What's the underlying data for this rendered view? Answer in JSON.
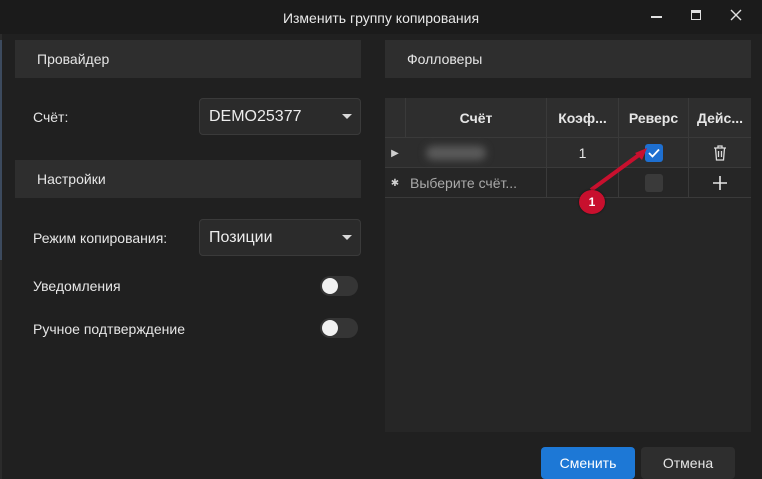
{
  "window": {
    "title": "Изменить группу копирования"
  },
  "provider": {
    "header": "Провайдер",
    "account_label": "Счёт:",
    "account_value": "DEMO25377"
  },
  "settings": {
    "header": "Настройки",
    "copy_mode_label": "Режим копирования:",
    "copy_mode_value": "Позиции",
    "notifications_label": "Уведомления",
    "notifications_on": false,
    "manual_confirm_label": "Ручное подтверждение",
    "manual_confirm_on": false
  },
  "followers": {
    "header": "Фолловеры",
    "columns": [
      "Счёт",
      "Коэф...",
      "Реверс",
      "Дейс..."
    ],
    "rows": [
      {
        "account": "",
        "coef": "1",
        "reverse": true,
        "action_icon": "trash-icon"
      }
    ],
    "new_row": {
      "placeholder": "Выберите счёт...",
      "reverse": false,
      "action_icon": "plus-icon"
    }
  },
  "annotation": {
    "number": "1",
    "color": "#c8102e"
  },
  "footer": {
    "apply_label": "Сменить",
    "cancel_label": "Отмена"
  },
  "colors": {
    "accent": "#1d78d6",
    "annotation": "#c8102e"
  }
}
